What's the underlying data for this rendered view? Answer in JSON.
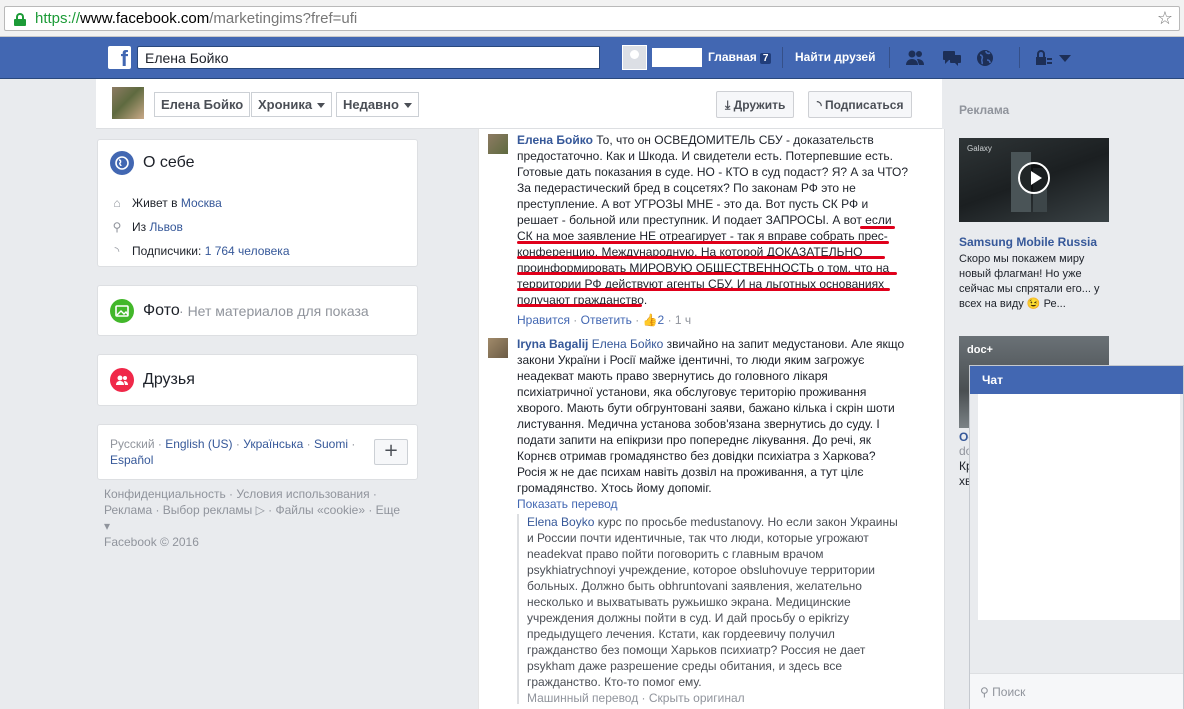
{
  "browser": {
    "url_scheme": "https://",
    "url_host": "www.facebook.com",
    "url_path": "/marketingims?fref=ufi",
    "star_icon": "star-icon"
  },
  "topbar": {
    "logo": "f",
    "search_value": "Елена Бойко",
    "home_label": "Главная",
    "home_count": "7",
    "find_friends_label": "Найти друзей"
  },
  "profile_bar": {
    "name_tab": "Елена Бойко",
    "timeline_tab": "Хроника",
    "recent_tab": "Недавно",
    "friend_button": "Дружить",
    "subscribe_button": "Подписаться"
  },
  "about": {
    "title": "О себе",
    "lives_prefix": "Живет в ",
    "lives_city": "Москва",
    "from_prefix": "Из ",
    "from_city": "Львов",
    "followers_prefix": "Подписчики: ",
    "followers_count": "1 764 человека"
  },
  "photos": {
    "title": "Фото",
    "subtitle": "Нет материалов для показа"
  },
  "friends": {
    "title": "Друзья"
  },
  "languages": {
    "line1_a": "Русский · ",
    "line1_b": "English (US)",
    "line1_c": " · ",
    "line1_d": "Українська",
    "line1_e": " · ",
    "line1_f": "Suomi",
    "line1_g": " ·",
    "line2": "Español",
    "plus": "+"
  },
  "footer": {
    "line1": "Конфиденциальность · Условия использования ·",
    "line2": "Реклама · Выбор рекламы",
    "line2b": " · Файлы «cookie» · Еще ▾",
    "line3": "Facebook © 2016"
  },
  "comments": {
    "c1": {
      "author": "Елена Бойко",
      "lines": [
        " То, что он ОСВЕДОМИТЕЛЬ СБУ - доказательств",
        "предостаточно. Как и Шкода. И свидетели есть. Потерпевшие есть.",
        "Готовые дать показания в суде. НО - КТО в суд подаст? Я? А за ЧТО?",
        "За педерастический бред в соцсетях? По законам РФ это не",
        "преступление. А вот УГРОЗЫ МНЕ - это да. Вот пусть СК РФ и",
        "решает - больной или преступник. И подает ЗАПРОСЫ. А вот если",
        "СК на мое заявление НЕ отреагирует - так я вправе собрать прес-",
        "конференцию. Международную. На которой ДОКАЗАТЕЛЬНО",
        "проинформировать МИРОВУЮ ОБЩЕСТВЕННОСТЬ о том, что на",
        "территории РФ действуют агенты СБУ. И на льготных основаниях",
        "получают гражданство."
      ],
      "like": "Нравится",
      "reply": "Ответить",
      "likes": "2",
      "time": "1 ч"
    },
    "c2": {
      "author": "Iryna Bagalij",
      "ref": "Елена Бойко",
      "lines": [
        " звичайно на запит медустанови. Але якщо",
        "закони України і Росії майже ідентичні, то люди яким загрожує",
        "неадекват мають право звернутись до головного лікаря",
        "психіатричної установи, яка обслуговує територію проживання",
        "хворого. Мають бути обгрунтовані заяви, бажано кілька і скрін шоти",
        "листування. Медична установа зобов'язана звернутись до суду. І",
        "подати запити на епікризи про попереднє лікування. До речі, як",
        "Корнєв отримав громадянство без довідки психіатра з Харкова?",
        "Росія ж не дає психам навіть дозвіл на проживання, а тут цілє",
        "громадянство. Хтось йому допомiг."
      ],
      "show_translation": "Показать перевод"
    },
    "translation": {
      "ref": "Elena Boyko",
      "lines": [
        " курс по просьбе medustanovy. Но если закон Украины",
        "и России почти идентичные, так что люди, которые угрожают",
        "neadekvat право пойти поговорить с главным врачом",
        "psykhiatrychnoyi учреждение, которое obsluhovuye территории",
        "больных. Должно быть obhruntovani заявления, желательно",
        "несколько и выхватывать ружьишко экрана. Медицинские",
        "учреждения должны пойти в суд. И дай просьбу о epikrizy",
        "предыдущего лечения. Кстати, как гордеевичу получил",
        "гражданство без помощи Харьков психиатр? Россия не дает",
        "psykham даже разрешение среды обитания, и здесь все",
        "гражданство. Кто-то помог ему."
      ],
      "footer": "Машинный перевод · Скрыть оригинал"
    }
  },
  "ads": {
    "title": "Реклама",
    "ad1_logo": "Galaxy",
    "ad1_name": "Samsung Mobile Russia",
    "ad1_text": "Скоро мы покажем миру новый флагман! Но уже сейчас мы спрятали его... у всех на виду 😉 Ре...",
    "ad2_logo": "doc+",
    "ad2_name": "Oc",
    "ad2_sub": "do",
    "ad2_text1": "Кр",
    "ad2_text2": "хв"
  },
  "chat": {
    "title": "Чат",
    "search_placeholder": "Поиск"
  },
  "colors": {
    "fb_blue": "#4267b2",
    "link": "#365899",
    "underline_red": "#e0001b",
    "about_icon": "#4267b2",
    "photo_icon": "#42b72a",
    "friends_icon": "#f02849"
  }
}
